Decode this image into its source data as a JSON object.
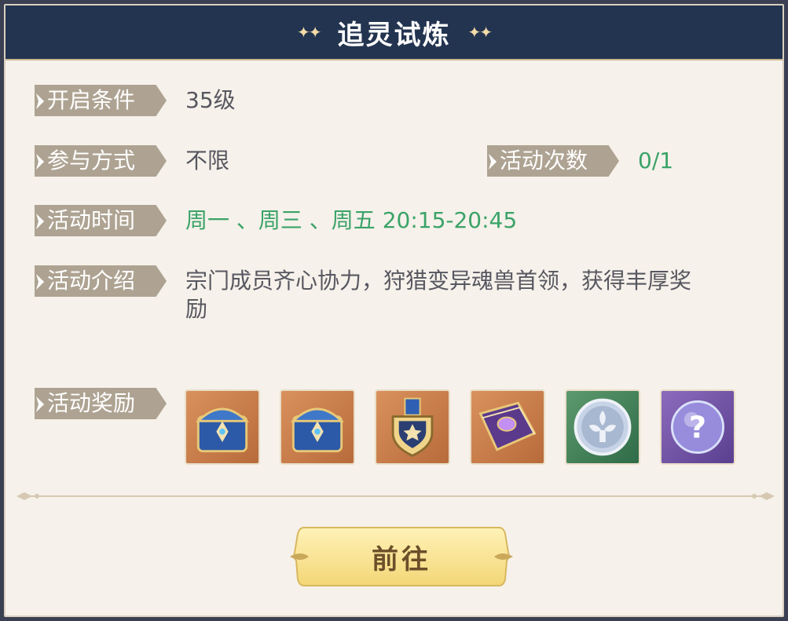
{
  "title": "追灵试炼",
  "sections": {
    "unlock": {
      "label": "开启条件",
      "value": "35级"
    },
    "participation": {
      "label": "参与方式",
      "value": "不限"
    },
    "attempts": {
      "label": "活动次数",
      "value": "0/1"
    },
    "time": {
      "label": "活动时间",
      "value": "周一 、周三 、周五 20:15-20:45"
    },
    "intro": {
      "label": "活动介绍",
      "line1": "宗门成员齐心协力，狩猎变异魂兽首领，获得丰厚奖",
      "line2": "励"
    },
    "rewards": {
      "label": "活动奖励"
    }
  },
  "rewards": [
    {
      "icon": "blue-treasure-chest-icon",
      "frame": "orange"
    },
    {
      "icon": "blue-treasure-chest-icon",
      "frame": "orange"
    },
    {
      "icon": "gold-medal-badge-icon",
      "frame": "orange"
    },
    {
      "icon": "purple-spellbook-icon",
      "frame": "orange"
    },
    {
      "icon": "silver-fleur-coin-icon",
      "frame": "green"
    },
    {
      "icon": "mystery-orb-icon",
      "frame": "purple"
    }
  ],
  "button": {
    "label": "前往"
  },
  "colors": {
    "title_bar": "#233450",
    "tag": "#aea392",
    "highlight_green": "#3aa368",
    "panel": "#f6f1ea"
  }
}
